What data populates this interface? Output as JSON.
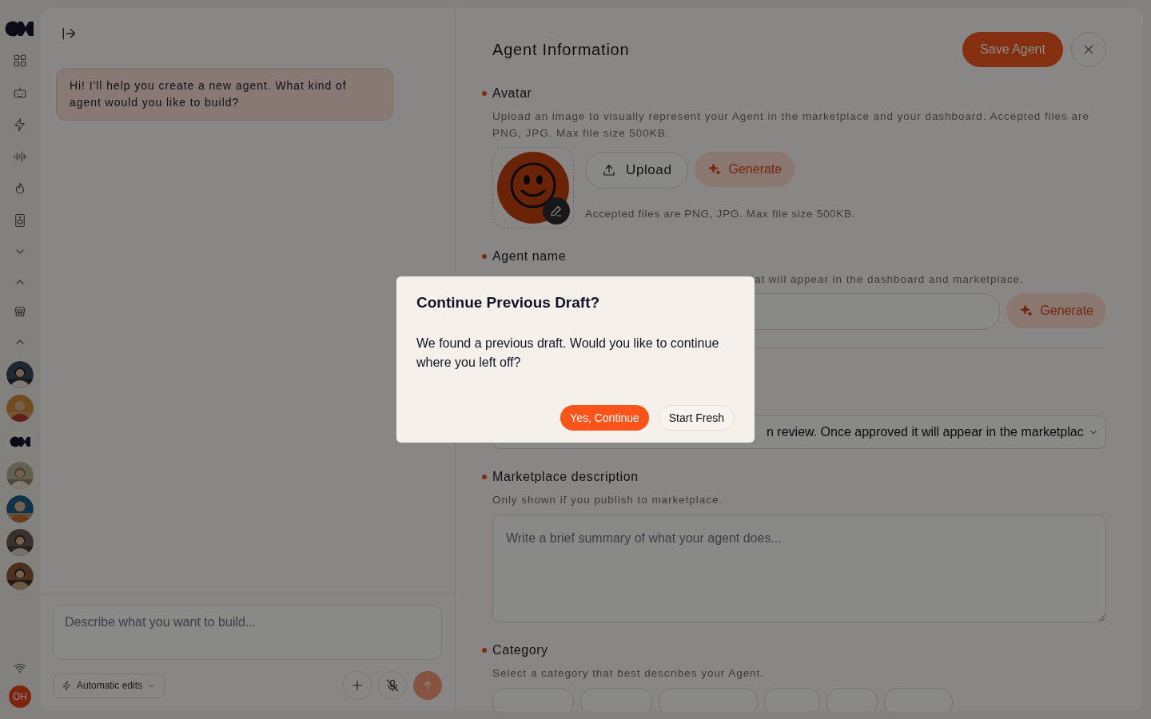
{
  "sidebar": {
    "agents": [
      {
        "kind": "picture"
      },
      {
        "kind": "picture"
      },
      {
        "kind": "logo"
      },
      {
        "kind": "picture"
      },
      {
        "kind": "picture"
      },
      {
        "kind": "picture"
      },
      {
        "kind": "picture"
      }
    ],
    "user_initials": "OH"
  },
  "chat": {
    "messages": [
      {
        "text": "Hi! I'll help you create a new agent. What kind of agent would you like to build?"
      }
    ],
    "input": {
      "placeholder": "Describe what you want to build..."
    },
    "mode_button": {
      "label": "Automatic edits"
    }
  },
  "form": {
    "title": "Agent Information",
    "save_button": "Save Agent",
    "avatar": {
      "label": "Avatar",
      "required": true,
      "description": "Upload an image to visually represent your Agent in the marketplace and your dashboard. Accepted files are PNG, JPG. Max file size 500KB.",
      "upload_button": "Upload",
      "generate_button": "Generate",
      "hint": "Accepted files are PNG, JPG. Max file size 500KB."
    },
    "agent_name": {
      "label": "Agent name",
      "required": true,
      "description": "at will appear in the dashboard and marketplace.",
      "generate_button": "Generate"
    },
    "visibility": {
      "value": "n review. Once approved it will appear in the marketplac"
    },
    "marketplace_description": {
      "label": "Marketplace description",
      "required": true,
      "description": "Only shown if you publish to marketplace.",
      "placeholder": "Write a brief summary of what your agent does..."
    },
    "category": {
      "label": "Category",
      "required": true,
      "description": "Select a category that best describes your Agent."
    }
  },
  "dialog": {
    "title": "Continue Previous Draft?",
    "message": "We found a previous draft. Would you like to continue where you left off?",
    "buttons": [
      {
        "label": "Yes, Continue",
        "kind": "primary"
      },
      {
        "label": "Start Fresh",
        "kind": "secondary"
      }
    ]
  }
}
